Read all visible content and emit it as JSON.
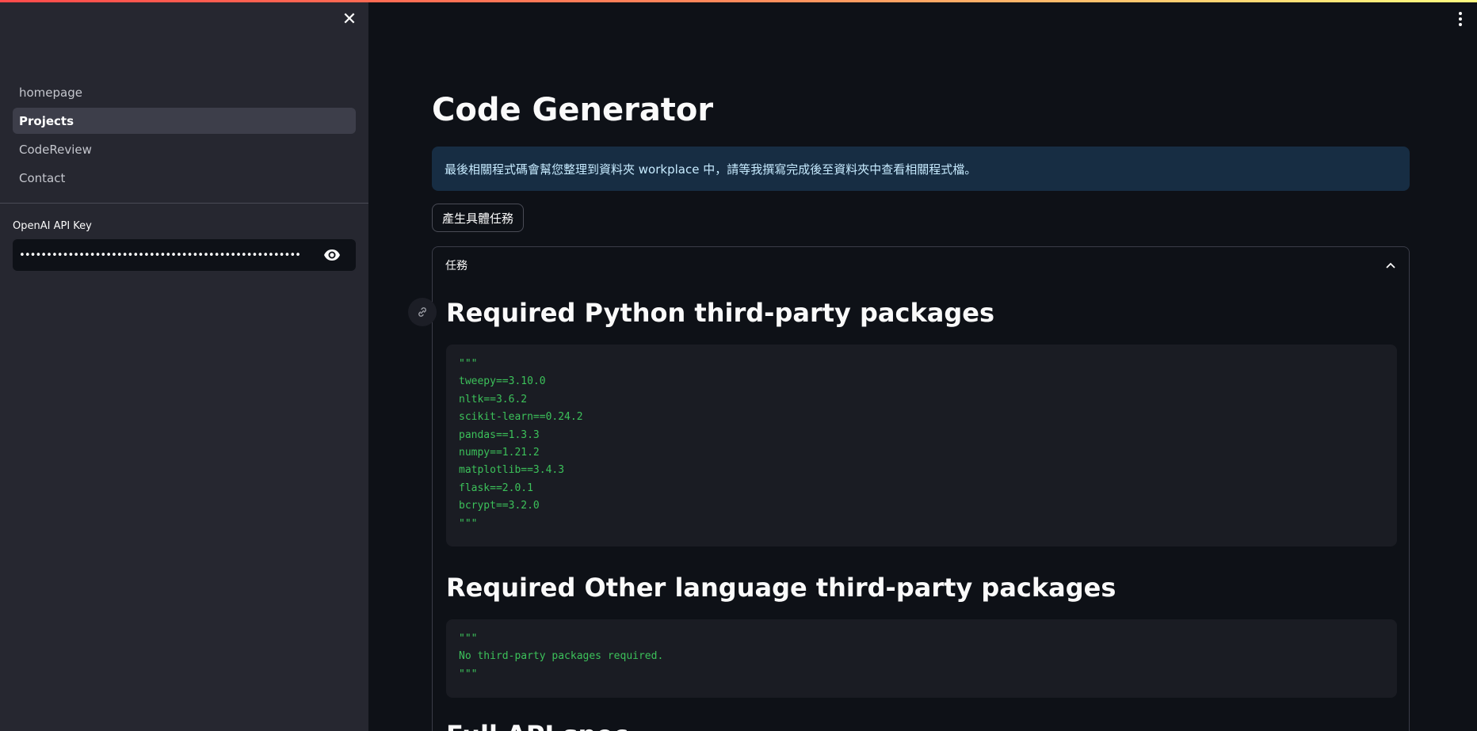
{
  "sidebar": {
    "nav": [
      {
        "label": "homepage",
        "active": false
      },
      {
        "label": "Projects",
        "active": true
      },
      {
        "label": "CodeReview",
        "active": false
      },
      {
        "label": "Contact",
        "active": false
      }
    ],
    "api_key_label": "OpenAI API Key",
    "api_key_value": "••••••••••••••••••••••••••••••••••••••••••••••••••••"
  },
  "main": {
    "title": "Code Generator",
    "info_text": "最後相關程式碼會幫您整理到資料夾 workplace 中，請等我撰寫完成後至資料夾中查看相關程式檔。",
    "task_button_label": "產生具體任務",
    "expander": {
      "title": "任務",
      "sections": [
        {
          "heading": "Required Python third-party packages",
          "code": [
            "\"\"\"",
            "tweepy==3.10.0",
            "nltk==3.6.2",
            "scikit-learn==0.24.2",
            "pandas==1.3.3",
            "numpy==1.21.2",
            "matplotlib==3.4.3",
            "flask==2.0.1",
            "bcrypt==3.2.0",
            "\"\"\""
          ]
        },
        {
          "heading": "Required Other language third-party packages",
          "code": [
            "\"\"\"",
            "No third-party packages required.",
            "\"\"\""
          ]
        },
        {
          "heading": "Full API spec",
          "code": []
        }
      ]
    }
  },
  "colors": {
    "accent": "#ff4b4b",
    "background": "#0e1117",
    "sidebar": "#262730",
    "code_text": "#3cc15a",
    "info_bg": "#172d43"
  }
}
